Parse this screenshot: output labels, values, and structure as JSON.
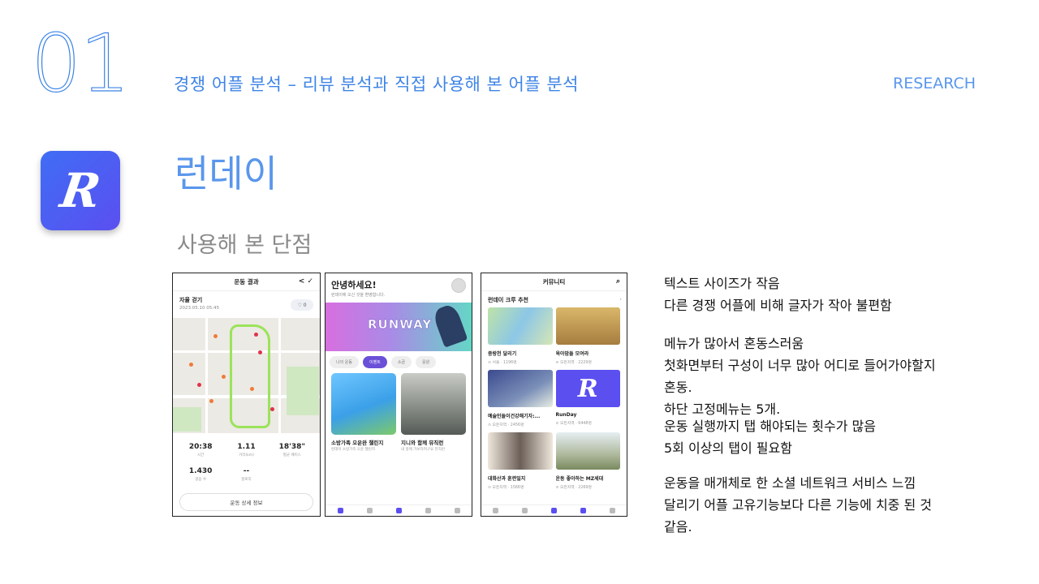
{
  "slide": {
    "number": "01",
    "title": "경쟁 어플 분석 – 리뷰 분석과 직접 사용해 본 어플 분석",
    "category": "RESEARCH"
  },
  "app": {
    "icon_letter": "R",
    "name": "런데이",
    "section": "사용해 본 단점"
  },
  "phone1": {
    "header": "운동 결과",
    "run_title": "자율 걷기",
    "run_date": "2023.05.10 05:45",
    "badge": "0",
    "stats": [
      {
        "value": "20:38",
        "label": "시간"
      },
      {
        "value": "1.11",
        "label": "거리(km)"
      },
      {
        "value": "18'38\"",
        "label": "평균 페이스"
      },
      {
        "value": "1.430",
        "label": "걸음 수"
      },
      {
        "value": "--",
        "label": "칼로리"
      }
    ],
    "button": "운동 상세 정보"
  },
  "phone2": {
    "greeting": "안녕하세요!",
    "subtitle": "런데이에 오신 것을 환영합니다.",
    "banner": "RUNWAY",
    "chips": [
      "나의 운동",
      "이벤트",
      "소금",
      "응원"
    ],
    "cards": [
      {
        "title": "소방가족 오운완 챌린지",
        "meta": "런데이 소방가족 오운 챌린지"
      },
      {
        "title": "지니와 함께 뮤직런",
        "meta": "내 방에 가보자려구요 뮤직런"
      }
    ]
  },
  "phone3": {
    "header": "커뮤니티",
    "section": "런데이 크루 추천",
    "crews": [
      {
        "name": "중랑천 달리기",
        "loc": "서울",
        "members": "1196명"
      },
      {
        "name": "육아맘들 모여라",
        "loc": "모든지역",
        "members": "2229명"
      },
      {
        "name": "예술인들이건강해기자:...",
        "loc": "모든지역",
        "members": "2456명"
      },
      {
        "name": "RunDay",
        "loc": "모든지역",
        "members": "6448명"
      },
      {
        "name": "대화산과 훈련일지",
        "loc": "모든지역",
        "members": "1566명"
      },
      {
        "name": "운동 좋아하는 MZ세대",
        "loc": "모든지역",
        "members": "2269명"
      }
    ]
  },
  "notes": [
    "텍스트 사이즈가 작음",
    "다른 경쟁 어플에 비해 글자가 작아 불편함",
    "메뉴가 많아서 혼동스러움",
    "첫화면부터 구성이 너무 많아 어디로 들어가야할지",
    "혼동.",
    "하단 고정메뉴는 5개.",
    "운동 실행까지 탭 해야되는  횟수가 많음",
    "5회 이상의 탭이 필요함",
    "운동을 매개체로 한 소셜 네트워크 서비스 느낌",
    "달리기 어플 고유기능보다 다른 기능에 치중 된 것",
    "같음."
  ]
}
